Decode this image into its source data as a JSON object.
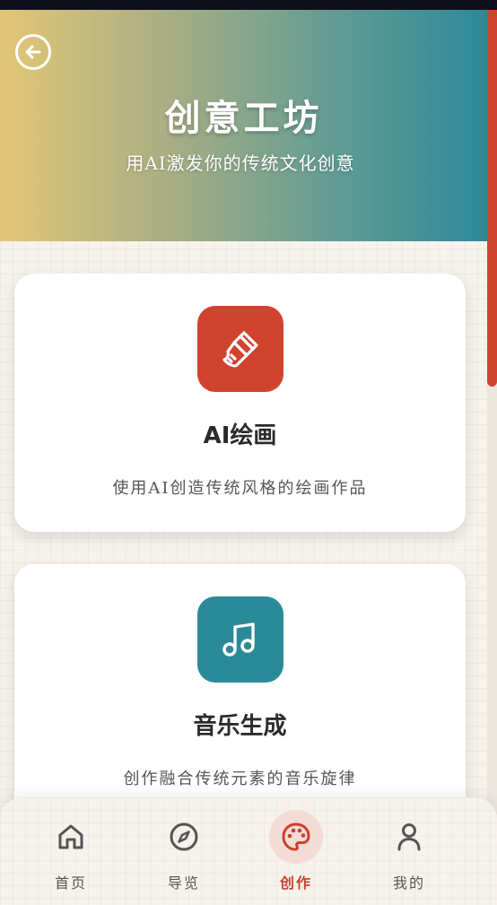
{
  "header": {
    "title": "创意工坊",
    "subtitle": "用AI激发你的传统文化创意",
    "back_icon": "arrow-left-circle-icon"
  },
  "cards": [
    {
      "title": "AI绘画",
      "description": "使用AI创造传统风格的绘画作品",
      "icon": "paint-brush-icon",
      "icon_color": "#d0432f"
    },
    {
      "title": "音乐生成",
      "description": "创作融合传统元素的音乐旋律",
      "icon": "music-note-icon",
      "icon_color": "#2b8a98"
    }
  ],
  "nav": {
    "items": [
      {
        "label": "首页",
        "icon": "home-icon",
        "active": false
      },
      {
        "label": "导览",
        "icon": "compass-icon",
        "active": false
      },
      {
        "label": "创作",
        "icon": "palette-icon",
        "active": true
      },
      {
        "label": "我的",
        "icon": "user-icon",
        "active": false
      }
    ]
  },
  "colors": {
    "accent_red": "#d0432f",
    "accent_teal": "#2b8a98",
    "gradient_start": "#e3c676",
    "background": "#f7f3ec"
  }
}
